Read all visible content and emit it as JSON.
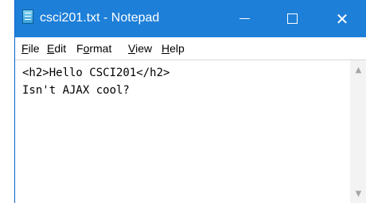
{
  "window": {
    "title": "csci201.txt - Notepad",
    "title_icon": "notepad-icon",
    "controls": {
      "minimize": "—",
      "maximize": "☐",
      "close": "✕"
    }
  },
  "menubar": {
    "items": [
      {
        "mnemonic": "F",
        "rest": "ile"
      },
      {
        "mnemonic": "E",
        "rest": "dit"
      },
      {
        "prefix": "F",
        "mnemonic": "o",
        "rest": "rmat"
      },
      {
        "mnemonic": "V",
        "rest": "iew"
      },
      {
        "mnemonic": "H",
        "rest": "elp"
      }
    ]
  },
  "editor": {
    "lines": [
      "<h2>Hello CSCI201</h2>",
      "Isn't AJAX cool?"
    ]
  },
  "scrollbar": {
    "up_icon": "chevron-up-icon",
    "down_icon": "chevron-down-icon"
  },
  "colors": {
    "titlebar": "#1d7fd8",
    "text": "#000000"
  }
}
